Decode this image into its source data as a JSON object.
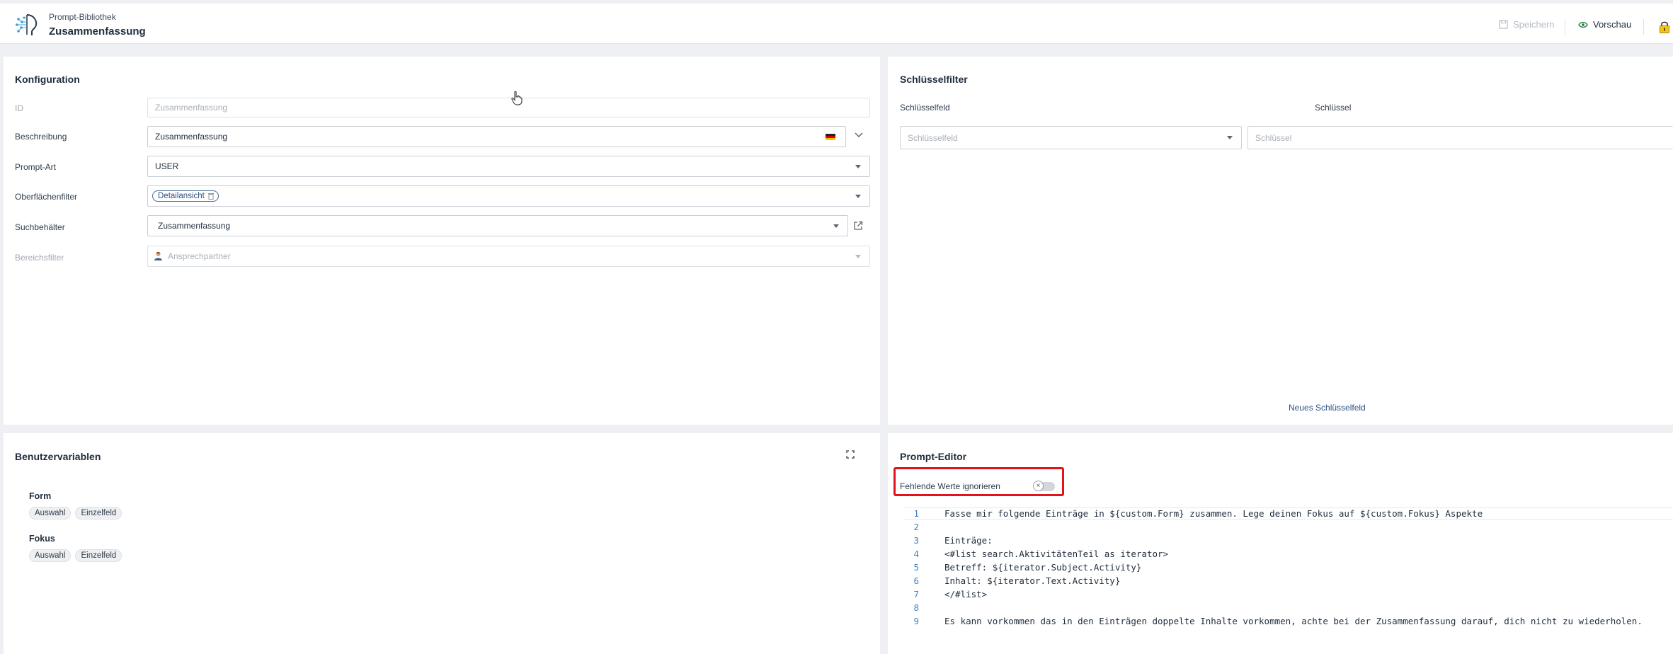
{
  "header": {
    "breadcrumb": "Prompt-Bibliothek",
    "title": "Zusammenfassung",
    "save_label": "Speichern",
    "preview_label": "Vorschau"
  },
  "config": {
    "title": "Konfiguration",
    "id_label": "ID",
    "id_placeholder": "Zusammenfassung",
    "desc_label": "Beschreibung",
    "desc_value": "Zusammenfassung",
    "type_label": "Prompt-Art",
    "type_value": "USER",
    "surface_label": "Oberflächenfilter",
    "surface_chip": "Detailansicht",
    "search_label": "Suchbehälter",
    "search_value": "Zusammenfassung",
    "area_label": "Bereichsfilter",
    "area_placeholder": "Ansprechpartner"
  },
  "keyfilter": {
    "title": "Schlüsselfilter",
    "col_keyfield": "Schlüsselfeld",
    "col_key": "Schlüssel",
    "keyfield_placeholder": "Schlüsselfeld",
    "key_placeholder": "Schlüssel",
    "new_link": "Neues Schlüsselfeld"
  },
  "vars": {
    "title": "Benutzervariablen",
    "items": [
      {
        "name": "Form",
        "tags": [
          "Auswahl",
          "Einzelfeld"
        ]
      },
      {
        "name": "Fokus",
        "tags": [
          "Auswahl",
          "Einzelfeld"
        ]
      }
    ]
  },
  "editor": {
    "title": "Prompt-Editor",
    "toggle_label": "Fehlende Werte ignorieren",
    "lines": [
      {
        "n": "1",
        "text": "Fasse mir folgende Einträge in ${custom.Form} zusammen. Lege deinen Fokus auf ${custom.Fokus} Aspekte"
      },
      {
        "n": "2",
        "text": ""
      },
      {
        "n": "3",
        "text": "Einträge:"
      },
      {
        "n": "4",
        "text": "<#list search.AktivitätenTeil as iterator>"
      },
      {
        "n": "5",
        "text": "Betreff: ${iterator.Subject.Activity}"
      },
      {
        "n": "6",
        "text": "Inhalt: ${iterator.Text.Activity}"
      },
      {
        "n": "7",
        "text": "</#list>"
      },
      {
        "n": "8",
        "text": ""
      },
      {
        "n": "9",
        "text": "Es kann vorkommen das in den Einträgen doppelte Inhalte vorkommen, achte bei der Zusammenfassung darauf, dich nicht zu wiederholen."
      }
    ]
  },
  "colors": {
    "accent": "#2c5282",
    "highlight": "#e0141c",
    "line_number": "#3b82c4"
  }
}
